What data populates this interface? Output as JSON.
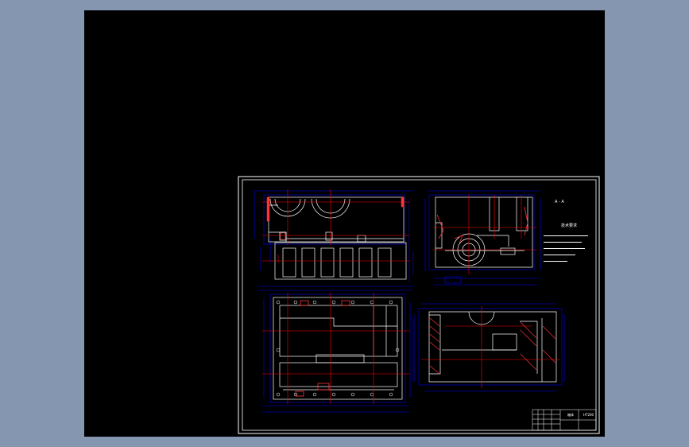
{
  "drawing": {
    "view_labels": {
      "top_right_view": "A - A"
    },
    "tech_notes": {
      "title": "技术要求",
      "lines": [
        "",
        "",
        "",
        "",
        ""
      ]
    },
    "title_block": {
      "name": "箱体",
      "material": "HT200",
      "code": ""
    },
    "colors": {
      "background": "#000000",
      "outline": "#ffffff",
      "dimension": "#0000ff",
      "centerline": "#ff0000",
      "hatch": "#ff3b3b",
      "desktop": "#8496b0"
    }
  }
}
